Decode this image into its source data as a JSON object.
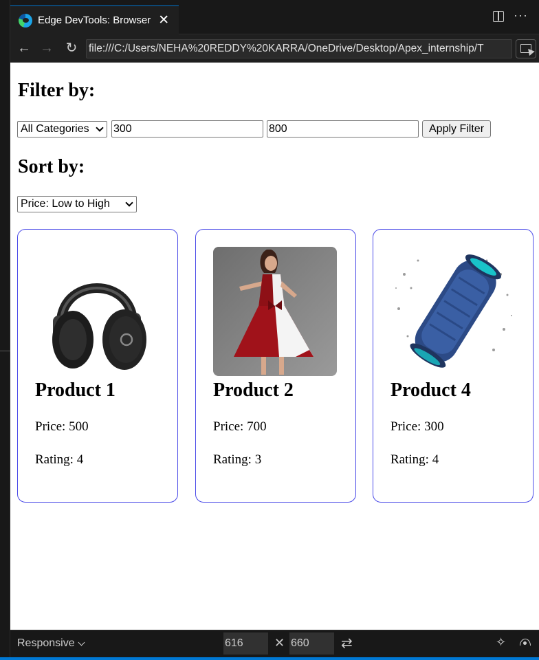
{
  "tab": {
    "title": "Edge DevTools: Browser"
  },
  "address_bar": {
    "url": "file:///C:/Users/NEHA%20REDDY%20KARRA/OneDrive/Desktop/Apex_internship/T"
  },
  "page": {
    "filter_heading": "Filter by:",
    "category_select": "All Categories",
    "min_price": "300",
    "max_price": "800",
    "apply_button": "Apply Filter",
    "sort_heading": "Sort by:",
    "sort_select": "Price: Low to High",
    "products": [
      {
        "name": "Product 1",
        "price": "Price: 500",
        "rating": "Rating: 4",
        "image": "headphones"
      },
      {
        "name": "Product 2",
        "price": "Price: 700",
        "rating": "Rating: 3",
        "image": "red-white-dress"
      },
      {
        "name": "Product 4",
        "price": "Price: 300",
        "rating": "Rating: 4",
        "image": "blue-speaker"
      }
    ]
  },
  "devtools_footer": {
    "device_mode": "Responsive",
    "width": "616",
    "height": "660"
  },
  "colors": {
    "accent": "#0078d4",
    "card_border": "#4a4ae8"
  }
}
